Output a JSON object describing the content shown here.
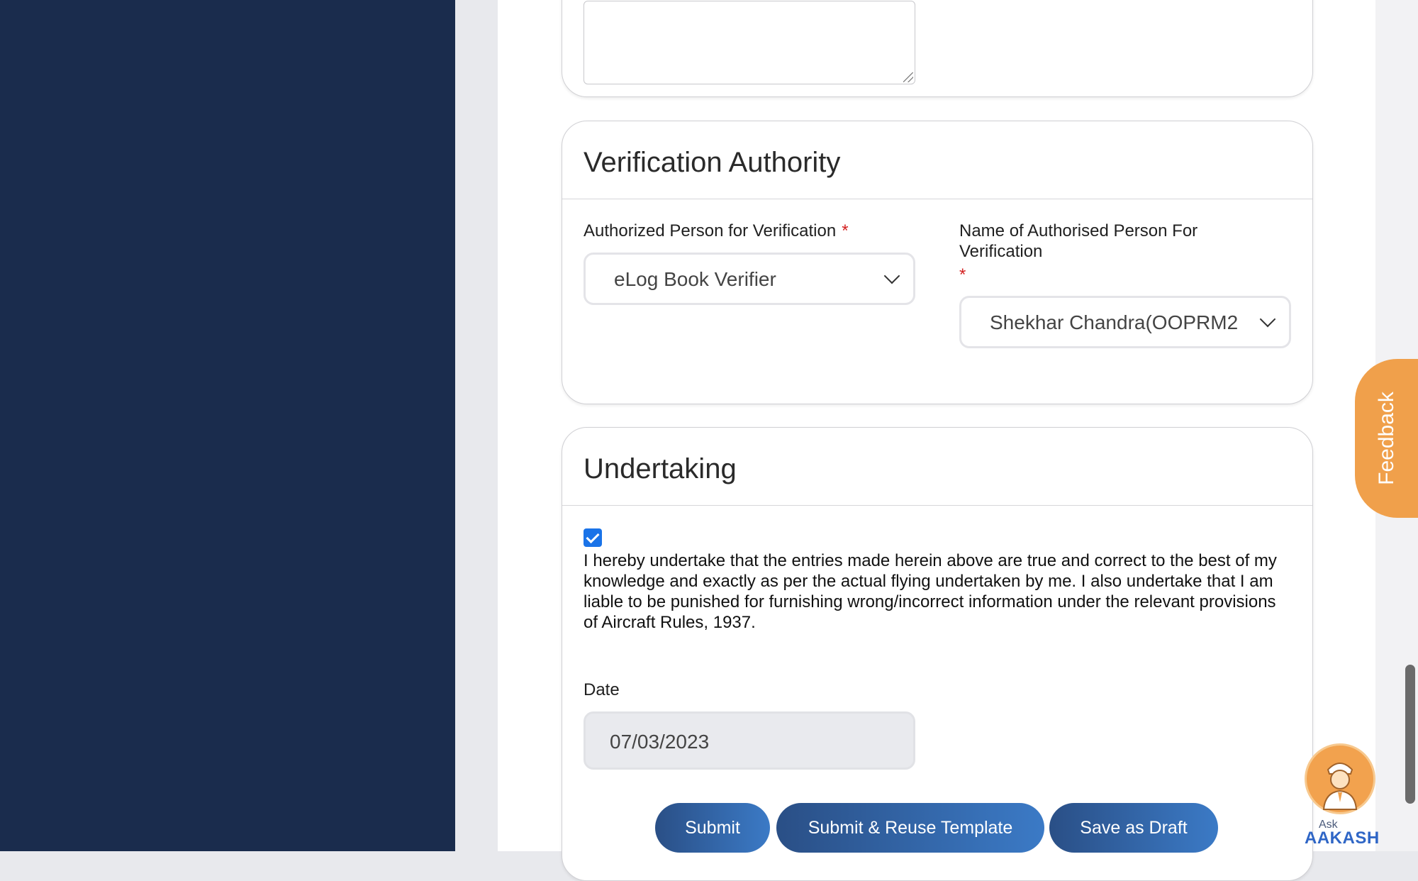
{
  "verification": {
    "title": "Verification Authority",
    "authorized_person_label": "Authorized Person for Verification",
    "authorized_person_value": "eLog Book Verifier",
    "name_label_line1": "Name of Authorised Person For",
    "name_label_line2": "Verification",
    "name_value": "Shekhar Chandra(OOPRM2",
    "required_marker": "*"
  },
  "undertaking": {
    "title": "Undertaking",
    "checked": true,
    "text": "I hereby undertake that the entries made herein above are true and correct to the best of my knowledge and exactly as per the actual flying undertaken by me. I also undertake that I am liable to be punished for furnishing wrong/incorrect information under the relevant provisions of Aircraft Rules, 1937.",
    "date_label": "Date",
    "date_value": "07/03/2023"
  },
  "actions": {
    "submit_label": "Submit",
    "submit_reuse_label": "Submit & Reuse Template",
    "save_draft_label": "Save as Draft"
  },
  "feedback": {
    "label": "Feedback"
  },
  "assistant": {
    "ask_label": "Ask",
    "name_label": "AAKASH",
    "icon": "pilot-avatar-icon"
  },
  "colors": {
    "sidebar": "#1a2c4d",
    "button_start": "#2a4f86",
    "button_end": "#3b7ac6",
    "feedback": "#f0a04b",
    "checkbox": "#1a73e8",
    "required": "#d32020"
  }
}
